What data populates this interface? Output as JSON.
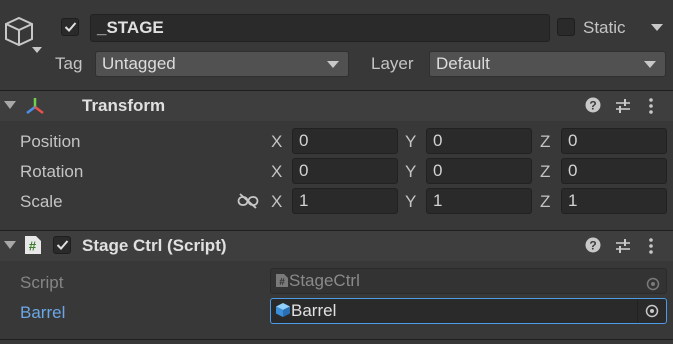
{
  "object": {
    "name": "_STAGE",
    "active": true,
    "static_label": "Static",
    "static_checked": false,
    "tag_label": "Tag",
    "tag_value": "Untagged",
    "layer_label": "Layer",
    "layer_value": "Default",
    "icon": "gameobject-cube-icon"
  },
  "transform": {
    "title": "Transform",
    "icon": "transform-axes-icon",
    "rows": [
      {
        "label": "Position",
        "x": "0",
        "y": "0",
        "z": "0"
      },
      {
        "label": "Rotation",
        "x": "0",
        "y": "0",
        "z": "0"
      },
      {
        "label": "Scale",
        "x": "1",
        "y": "1",
        "z": "1"
      }
    ],
    "axis_labels": {
      "x": "X",
      "y": "Y",
      "z": "Z"
    }
  },
  "script_component": {
    "title": "Stage Ctrl (Script)",
    "enabled": true,
    "icon": "csharp-script-hash-icon",
    "fields": [
      {
        "label": "Script",
        "value": "StageCtrl",
        "disabled": true,
        "icon": "script-hash-icon"
      },
      {
        "label": "Barrel",
        "value": "Barrel",
        "disabled": false,
        "icon": "prefab-cube-icon"
      }
    ]
  },
  "colors": {
    "background": "#383838",
    "header": "#3e3e3e",
    "field": "#2a2a2a",
    "accent_blue": "#4c9be8",
    "barrel_label": "#6aa7e6"
  }
}
